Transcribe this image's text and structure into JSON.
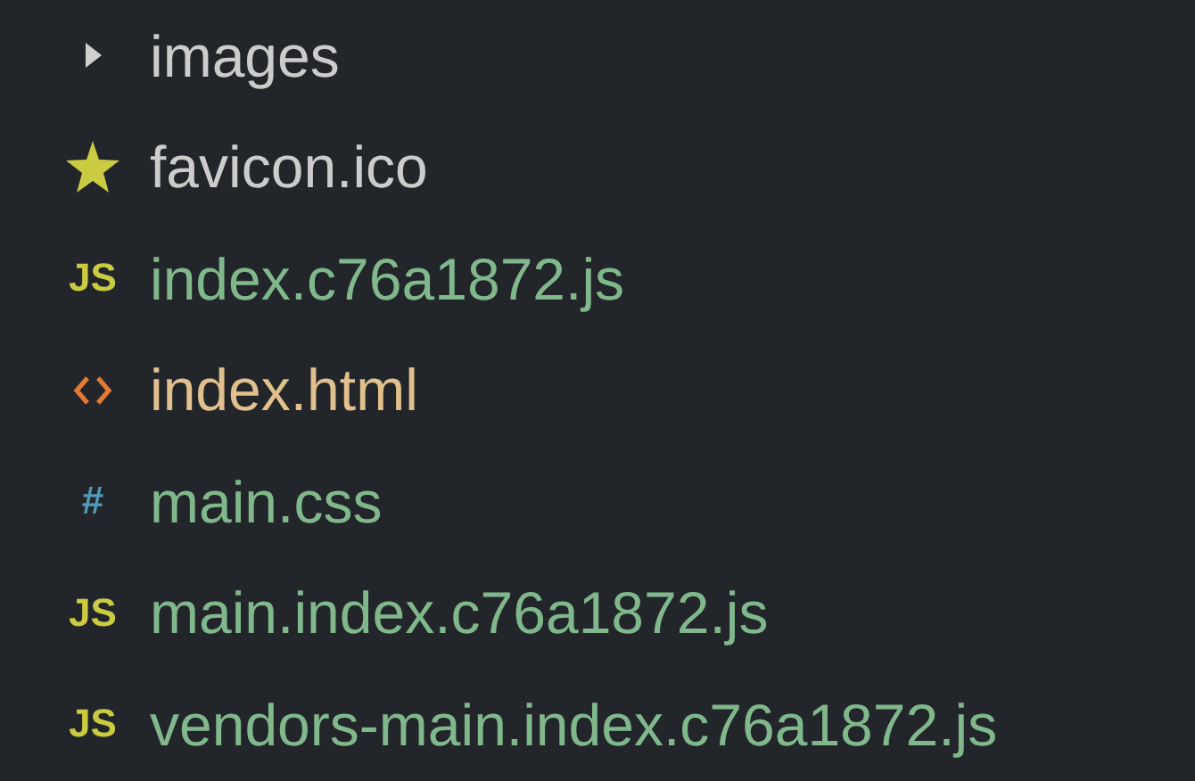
{
  "explorer": {
    "items": [
      {
        "label": "images",
        "kind": "folder",
        "expanded": false,
        "color": "#cccccc"
      },
      {
        "label": "favicon.ico",
        "kind": "star",
        "color": "#cccccc"
      },
      {
        "label": "index.c76a1872.js",
        "kind": "js",
        "badge": "JS",
        "color": "#81b88b"
      },
      {
        "label": "index.html",
        "kind": "html",
        "color": "#e2c08d"
      },
      {
        "label": "main.css",
        "kind": "css",
        "badge": "#",
        "color": "#81b88b"
      },
      {
        "label": "main.index.c76a1872.js",
        "kind": "js",
        "badge": "JS",
        "color": "#81b88b"
      },
      {
        "label": "vendors-main.index.c76a1872.js",
        "kind": "js",
        "badge": "JS",
        "color": "#81b88b"
      }
    ]
  }
}
